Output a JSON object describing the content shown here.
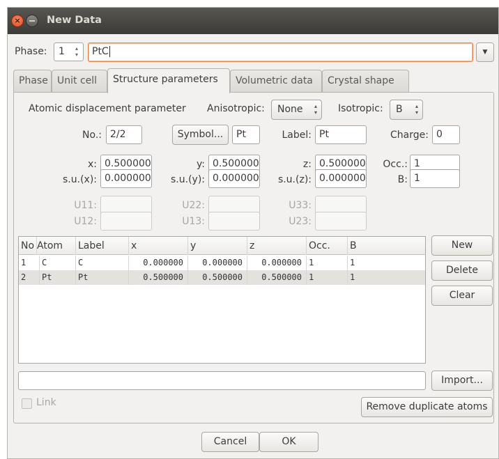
{
  "window": {
    "title": "New Data"
  },
  "phase_row": {
    "label": "Phase:",
    "value": "1",
    "name": "PtC"
  },
  "tabs": [
    "Phase",
    "Unit cell",
    "Structure parameters",
    "Volumetric data",
    "Crystal shape"
  ],
  "active_tab": "Structure parameters",
  "adp": {
    "heading": "Atomic displacement parameter",
    "anisotropic_label": "Anisotropic:",
    "anisotropic_value": "None",
    "isotropic_label": "Isotropic:",
    "isotropic_value": "B"
  },
  "atom": {
    "no_label": "No.:",
    "no_value": "2/2",
    "symbol_button": "Symbol...",
    "symbol_value": "Pt",
    "label_label": "Label:",
    "label_value": "Pt",
    "charge_label": "Charge:",
    "charge_value": "0",
    "x_label": "x:",
    "x_value": "0.500000",
    "y_label": "y:",
    "y_value": "0.500000",
    "z_label": "z:",
    "z_value": "0.500000",
    "occ_label": "Occ.:",
    "occ_value": "1",
    "sux_label": "s.u.(x):",
    "sux_value": "0.000000",
    "suy_label": "s.u.(y):",
    "suy_value": "0.000000",
    "suz_label": "s.u.(z):",
    "suz_value": "0.000000",
    "b_label": "B:",
    "b_value": "1",
    "u11_label": "U11:",
    "u22_label": "U22:",
    "u33_label": "U33:",
    "u12_label": "U12:",
    "u13_label": "U13:",
    "u23_label": "U23:"
  },
  "table": {
    "columns": [
      "No",
      "Atom",
      "Label",
      "x",
      "y",
      "z",
      "Occ.",
      "B"
    ],
    "rows": [
      [
        "1",
        "C",
        "C",
        "0.000000",
        "0.000000",
        "0.000000",
        "1",
        "1"
      ],
      [
        "2",
        "Pt",
        "Pt",
        "0.500000",
        "0.500000",
        "0.500000",
        "1",
        "1"
      ]
    ],
    "selected_row": 1
  },
  "side_buttons": {
    "new": "New",
    "delete": "Delete",
    "clear": "Clear"
  },
  "import_button": "Import...",
  "import_path": "",
  "link_label": "Link",
  "remove_duplicates_button": "Remove duplicate atoms",
  "footer": {
    "cancel": "Cancel",
    "ok": "OK"
  },
  "icons": {
    "close": "close-icon",
    "minimize": "minimize-icon",
    "spin": "spin-arrows-icon",
    "dropdown": "dropdown-arrow-icon"
  }
}
